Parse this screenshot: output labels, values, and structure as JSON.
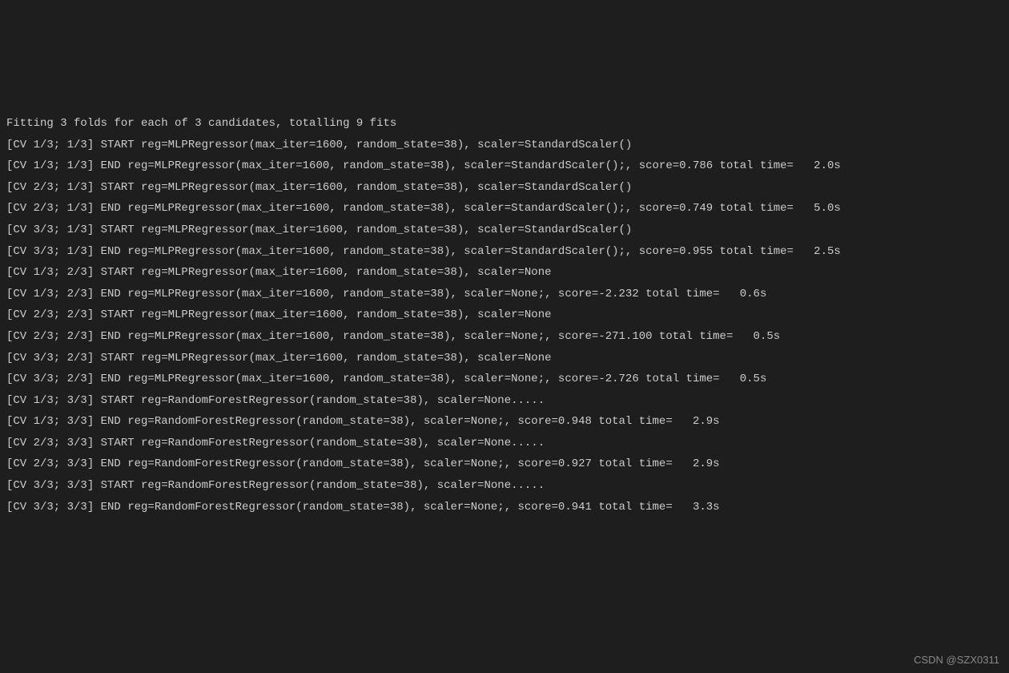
{
  "terminal": {
    "header": "Fitting 3 folds for each of 3 candidates, totalling 9 fits",
    "lines": [
      "[CV 1/3; 1/3] START reg=MLPRegressor(max_iter=1600, random_state=38), scaler=StandardScaler()",
      "[CV 1/3; 1/3] END reg=MLPRegressor(max_iter=1600, random_state=38), scaler=StandardScaler();, score=0.786 total time=   2.0s",
      "[CV 2/3; 1/3] START reg=MLPRegressor(max_iter=1600, random_state=38), scaler=StandardScaler()",
      "[CV 2/3; 1/3] END reg=MLPRegressor(max_iter=1600, random_state=38), scaler=StandardScaler();, score=0.749 total time=   5.0s",
      "[CV 3/3; 1/3] START reg=MLPRegressor(max_iter=1600, random_state=38), scaler=StandardScaler()",
      "[CV 3/3; 1/3] END reg=MLPRegressor(max_iter=1600, random_state=38), scaler=StandardScaler();, score=0.955 total time=   2.5s",
      "[CV 1/3; 2/3] START reg=MLPRegressor(max_iter=1600, random_state=38), scaler=None",
      "[CV 1/3; 2/3] END reg=MLPRegressor(max_iter=1600, random_state=38), scaler=None;, score=-2.232 total time=   0.6s",
      "[CV 2/3; 2/3] START reg=MLPRegressor(max_iter=1600, random_state=38), scaler=None",
      "[CV 2/3; 2/3] END reg=MLPRegressor(max_iter=1600, random_state=38), scaler=None;, score=-271.100 total time=   0.5s",
      "[CV 3/3; 2/3] START reg=MLPRegressor(max_iter=1600, random_state=38), scaler=None",
      "[CV 3/3; 2/3] END reg=MLPRegressor(max_iter=1600, random_state=38), scaler=None;, score=-2.726 total time=   0.5s",
      "[CV 1/3; 3/3] START reg=RandomForestRegressor(random_state=38), scaler=None.....",
      "[CV 1/3; 3/3] END reg=RandomForestRegressor(random_state=38), scaler=None;, score=0.948 total time=   2.9s",
      "[CV 2/3; 3/3] START reg=RandomForestRegressor(random_state=38), scaler=None.....",
      "[CV 2/3; 3/3] END reg=RandomForestRegressor(random_state=38), scaler=None;, score=0.927 total time=   2.9s",
      "[CV 3/3; 3/3] START reg=RandomForestRegressor(random_state=38), scaler=None.....",
      "[CV 3/3; 3/3] END reg=RandomForestRegressor(random_state=38), scaler=None;, score=0.941 total time=   3.3s"
    ]
  },
  "watermark": "CSDN @SZX0311"
}
